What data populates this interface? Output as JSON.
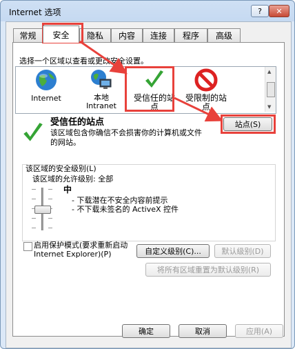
{
  "window": {
    "title": "Internet 选项",
    "help_label": "?",
    "close_label": "✕"
  },
  "tabs": [
    {
      "label": "常规"
    },
    {
      "label": "安全"
    },
    {
      "label": "隐私"
    },
    {
      "label": "内容"
    },
    {
      "label": "连接"
    },
    {
      "label": "程序"
    },
    {
      "label": "高级"
    }
  ],
  "security": {
    "select_zone_prompt": "选择一个区域以查看或更改安全设置。",
    "zones": [
      {
        "label": "Internet",
        "icon": "globe-icon"
      },
      {
        "label": "本地\nIntranet",
        "icon": "intranet-icon"
      },
      {
        "label": "受信任的站\n点",
        "icon": "checkmark-icon"
      },
      {
        "label": "受限制的站\n点",
        "icon": "restricted-icon"
      }
    ],
    "zone_title": "受信任的站点",
    "zone_description": "该区域包含你确信不会损害你的计算机或文件\n的网站。",
    "sites_button": "站点(S)",
    "level_group_label": "该区域的安全级别(L)",
    "allowed_levels": "该区域的允许级别: 全部",
    "level_name": "中",
    "level_details": [
      "- 下载潜在不安全内容前提示",
      "- 不下载未签名的 ActiveX 控件"
    ],
    "protected_mode_label": "启用保护模式(要求重新启动\nInternet Explorer)(P)",
    "custom_level_button": "自定义级别(C)...",
    "default_level_button": "默认级别(D)",
    "reset_all_button": "将所有区域重置为默认级别(R)"
  },
  "footer": {
    "ok": "确定",
    "cancel": "取消",
    "apply": "应用(A)"
  },
  "colors": {
    "highlight": "#e8413b"
  }
}
